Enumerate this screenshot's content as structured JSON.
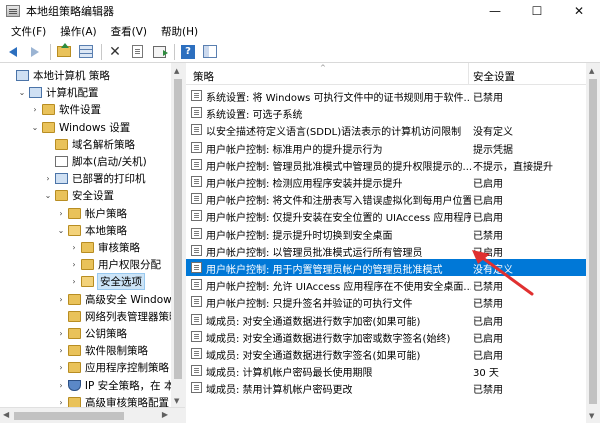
{
  "window": {
    "title": "本地组策略编辑器",
    "minimize": "—",
    "maximize": "☐",
    "close": "✕"
  },
  "menu": [
    "文件(F)",
    "操作(A)",
    "查看(V)",
    "帮助(H)"
  ],
  "toolbar_icons": [
    "back-icon",
    "forward-icon",
    "up-folder-icon",
    "show-tree-icon",
    "delete-icon",
    "properties-icon",
    "export-icon",
    "help-icon",
    "panel-icon"
  ],
  "tree": [
    {
      "label": "本地计算机 策略",
      "icon": "computer-icon",
      "expander": "",
      "level": 0
    },
    {
      "label": "计算机配置",
      "icon": "computer-icon",
      "expander": "⌄",
      "level": 1
    },
    {
      "label": "软件设置",
      "icon": "folder-icon",
      "expander": "›",
      "level": 2
    },
    {
      "label": "Windows 设置",
      "icon": "folder-icon",
      "expander": "⌄",
      "level": 2
    },
    {
      "label": "域名解析策略",
      "icon": "folder-icon",
      "expander": "",
      "level": 3
    },
    {
      "label": "脚本(启动/关机)",
      "icon": "document-icon",
      "expander": "",
      "level": 3
    },
    {
      "label": "已部署的打印机",
      "icon": "printer-icon",
      "expander": "›",
      "level": 3
    },
    {
      "label": "安全设置",
      "icon": "folder-icon",
      "expander": "⌄",
      "level": 3
    },
    {
      "label": "帐户策略",
      "icon": "folder-icon",
      "expander": "›",
      "level": 4
    },
    {
      "label": "本地策略",
      "icon": "folder-open-icon",
      "expander": "⌄",
      "level": 4
    },
    {
      "label": "审核策略",
      "icon": "folder-icon",
      "expander": "›",
      "level": 5
    },
    {
      "label": "用户权限分配",
      "icon": "folder-icon",
      "expander": "›",
      "level": 5
    },
    {
      "label": "安全选项",
      "icon": "folder-open-icon",
      "expander": "›",
      "level": 5
    },
    {
      "label": "高级安全 Windows",
      "icon": "folder-icon",
      "expander": "›",
      "level": 4
    },
    {
      "label": "网络列表管理器策略",
      "icon": "folder-icon",
      "expander": "",
      "level": 4
    },
    {
      "label": "公钥策略",
      "icon": "folder-icon",
      "expander": "›",
      "level": 4
    },
    {
      "label": "软件限制策略",
      "icon": "folder-icon",
      "expander": "›",
      "level": 4
    },
    {
      "label": "应用程序控制策略",
      "icon": "folder-icon",
      "expander": "›",
      "level": 4
    },
    {
      "label": "IP 安全策略，在 本地",
      "icon": "shield-icon",
      "expander": "›",
      "level": 4
    },
    {
      "label": "高级审核策略配置",
      "icon": "folder-icon",
      "expander": "›",
      "level": 4
    }
  ],
  "list_header": {
    "policy": "策略",
    "setting": "安全设置",
    "sort_indicator": "^"
  },
  "policies": [
    {
      "name": "系统设置: 将 Windows 可执行文件中的证书规则用于软件...",
      "value": "已禁用"
    },
    {
      "name": "系统设置: 可选子系统",
      "value": ""
    },
    {
      "name": "以安全描述符定义语言(SDDL)语法表示的计算机访问限制",
      "value": "没有定义"
    },
    {
      "name": "用户帐户控制: 标准用户的提升提示行为",
      "value": "提示凭据"
    },
    {
      "name": "用户帐户控制: 管理员批准模式中管理员的提升权限提示的...",
      "value": "不提示，直接提升"
    },
    {
      "name": "用户帐户控制: 检测应用程序安装并提示提升",
      "value": "已启用"
    },
    {
      "name": "用户帐户控制: 将文件和注册表写入错误虚拟化到每用户位置",
      "value": "已启用"
    },
    {
      "name": "用户帐户控制: 仅提升安装在安全位置的 UIAccess 应用程序",
      "value": "已启用"
    },
    {
      "name": "用户帐户控制: 提示提升时切换到安全桌面",
      "value": "已禁用"
    },
    {
      "name": "用户帐户控制: 以管理员批准模式运行所有管理员",
      "value": "已启用"
    },
    {
      "name": "用户帐户控制: 用于内置管理员帐户的管理员批准模式",
      "value": "没有定义"
    },
    {
      "name": "用户帐户控制: 允许 UIAccess 应用程序在不使用安全桌面...",
      "value": "已禁用"
    },
    {
      "name": "用户帐户控制: 只提升签名并验证的可执行文件",
      "value": "已禁用"
    },
    {
      "name": "域成员: 对安全通道数据进行数字加密(如果可能)",
      "value": "已启用"
    },
    {
      "name": "域成员: 对安全通道数据进行数字加密或数字签名(始终)",
      "value": "已启用"
    },
    {
      "name": "域成员: 对安全通道数据进行数字签名(如果可能)",
      "value": "已启用"
    },
    {
      "name": "域成员: 计算机帐户密码最长使用期限",
      "value": "30 天"
    },
    {
      "name": "域成员: 禁用计算机帐户密码更改",
      "value": "已禁用"
    }
  ],
  "selected_tree_index": 12,
  "selected_policy_index": 10,
  "colors": {
    "selection": "#0078d7",
    "tree_selection": "#cce4f7",
    "annotation_arrow": "#e03030"
  }
}
